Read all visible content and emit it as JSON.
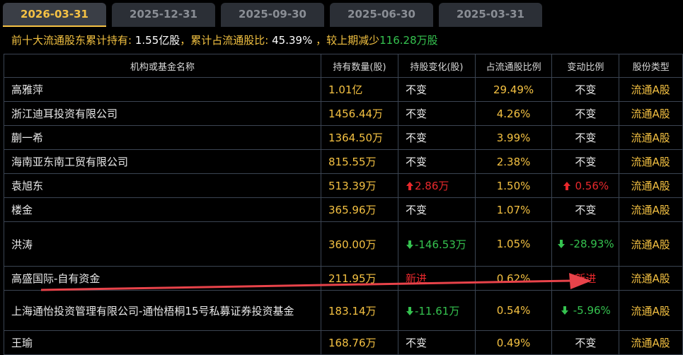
{
  "tabs": [
    "2026-03-31",
    "2025-12-31",
    "2025-09-30",
    "2025-06-30",
    "2025-03-31"
  ],
  "summary": {
    "label1": "前十大流通股东累计持有",
    "sep": ":",
    "value1": "1.55亿股",
    "label2": "，累计占流通股比",
    "value2": "45.39%",
    "label3": "，较上期减少",
    "value3": "116.28万股"
  },
  "headers": [
    "机构或基金名称",
    "持有数量(股)",
    "持股变化(股)",
    "占流通股比例",
    "变动比例",
    "股份类型"
  ],
  "rows": [
    {
      "name": "高雅萍",
      "qty": "1.01亿",
      "change": "不变",
      "change_kind": "same",
      "pct": "29.49%",
      "ratio": "不变",
      "ratio_kind": "same",
      "type": "流通A股"
    },
    {
      "name": "浙江迪耳投资有限公司",
      "qty": "1456.44万",
      "change": "不变",
      "change_kind": "same",
      "pct": "4.26%",
      "ratio": "不变",
      "ratio_kind": "same",
      "type": "流通A股"
    },
    {
      "name": "蒯一希",
      "qty": "1364.50万",
      "change": "不变",
      "change_kind": "same",
      "pct": "3.99%",
      "ratio": "不变",
      "ratio_kind": "same",
      "type": "流通A股"
    },
    {
      "name": "海南亚东南工贸有限公司",
      "qty": "815.55万",
      "change": "不变",
      "change_kind": "same",
      "pct": "2.38%",
      "ratio": "不变",
      "ratio_kind": "same",
      "type": "流通A股"
    },
    {
      "name": "袁旭东",
      "qty": "513.39万",
      "change": "2.86万",
      "change_kind": "up",
      "pct": "1.50%",
      "ratio": "0.56%",
      "ratio_kind": "up",
      "type": "流通A股"
    },
    {
      "name": "楼金",
      "qty": "365.96万",
      "change": "不变",
      "change_kind": "same",
      "pct": "1.07%",
      "ratio": "不变",
      "ratio_kind": "same",
      "type": "流通A股"
    },
    {
      "name": "洪涛",
      "qty": "360.00万",
      "change": "-146.53万",
      "change_kind": "down",
      "pct": "1.05%",
      "ratio": "-28.93%",
      "ratio_kind": "down",
      "type": "流通A股"
    },
    {
      "name": "高盛国际-自有资金",
      "qty": "211.95万",
      "change": "新进",
      "change_kind": "new",
      "pct": "0.62%",
      "ratio": "新进",
      "ratio_kind": "new",
      "type": "流通A股"
    },
    {
      "name": "上海通怡投资管理有限公司-通怡梧桐15号私募证券投资基金",
      "qty": "183.14万",
      "change": "-11.61万",
      "change_kind": "down",
      "pct": "0.54%",
      "ratio": "-5.96%",
      "ratio_kind": "down",
      "type": "流通A股"
    },
    {
      "name": "王瑜",
      "qty": "168.76万",
      "change": "不变",
      "change_kind": "same",
      "pct": "0.49%",
      "ratio": "不变",
      "ratio_kind": "same",
      "type": "流通A股"
    }
  ],
  "colors": {
    "up": "#e8282c",
    "down": "#35c24f",
    "accent": "#f4c142",
    "annotation": "#e8434a"
  }
}
